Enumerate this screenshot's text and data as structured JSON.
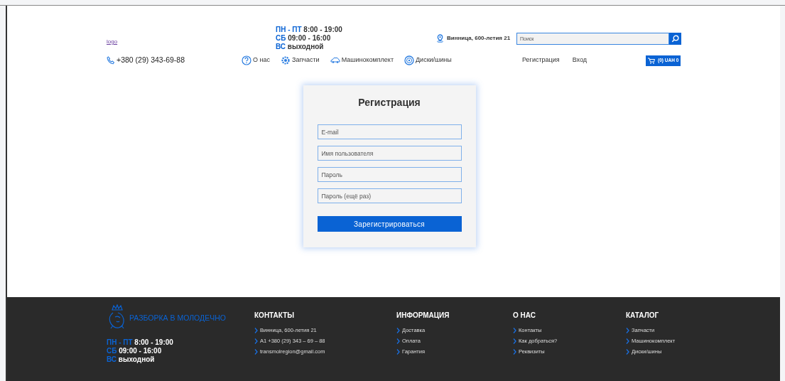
{
  "header": {
    "logo": "logo",
    "schedule": [
      {
        "days": "ПН - ПТ",
        "hours": "8:00 - 19:00"
      },
      {
        "days": "СБ",
        "hours": "09:00 - 16:00"
      },
      {
        "days": "ВС",
        "hours": "выходной"
      }
    ],
    "address": "Винница, 600-летия 21",
    "search": {
      "placeholder": "Поиск"
    },
    "phone": "+380 (29) 343-69-88",
    "nav": [
      {
        "label": "О нас",
        "kind": "question"
      },
      {
        "label": "Запчасти",
        "kind": "parts"
      },
      {
        "label": "Машинокомплект",
        "kind": "car"
      },
      {
        "label": "Диски/шины",
        "kind": "wheel"
      }
    ],
    "account_links": [
      "Регистрация",
      "Вход"
    ],
    "cart": "(0) UAH 0"
  },
  "form": {
    "title": "Регистрация",
    "fields": [
      {
        "placeholder": "E-mail"
      },
      {
        "placeholder": "Имя пользователя"
      },
      {
        "placeholder": "Пароль"
      },
      {
        "placeholder": "Пароль (ещё раз)"
      }
    ],
    "submit": "Зарегистрироваться"
  },
  "footer": {
    "brand": "РАЗБОРКА В МОЛОДЕЧНО",
    "schedule": [
      {
        "days": "ПН - ПТ",
        "hours": "8:00 - 19:00"
      },
      {
        "days": "СБ",
        "hours": "09:00 - 16:00"
      },
      {
        "days": "ВС",
        "hours": "выходной"
      }
    ],
    "columns": [
      {
        "title": "КОНТАКТЫ",
        "links": [
          "Винница, 600-летия 21",
          "A1 +380 (29) 343 – 69 – 88",
          "transmolregion@gmail.com"
        ]
      },
      {
        "title": "ИНФОРМАЦИЯ",
        "links": [
          "Доставка",
          "Оплата",
          "Гарантия"
        ]
      },
      {
        "title": "О НАС",
        "links": [
          "Контакты",
          "Как добраться?",
          "Реквизиты"
        ]
      },
      {
        "title": "КАТАЛОГ",
        "links": [
          "Запчасти",
          "Машинокомплект",
          "Диски/шины"
        ]
      }
    ]
  }
}
